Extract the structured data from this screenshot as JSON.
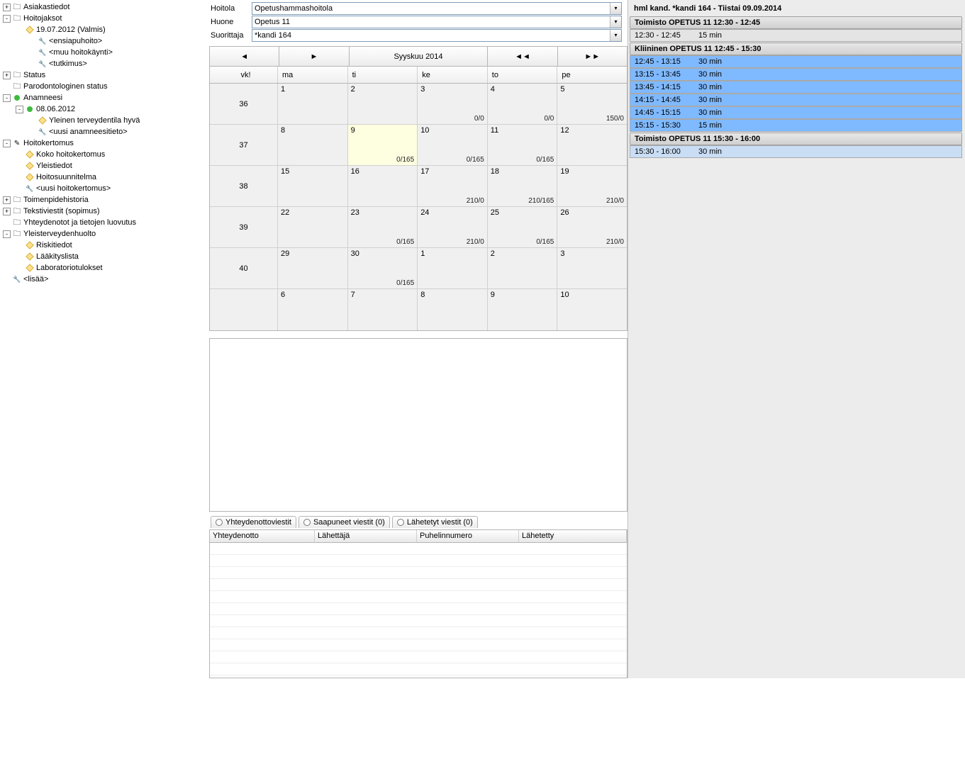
{
  "tree": [
    {
      "level": 0,
      "exp": "+",
      "icon": "folder",
      "label": "Asiakastiedot"
    },
    {
      "level": 0,
      "exp": "-",
      "icon": "folder",
      "label": "Hoitojaksot"
    },
    {
      "level": 1,
      "exp": "",
      "icon": "doc",
      "label": "19.07.2012 (Valmis)"
    },
    {
      "level": 2,
      "exp": "",
      "icon": "wrench",
      "label": "<ensiapuhoito>"
    },
    {
      "level": 2,
      "exp": "",
      "icon": "wrench",
      "label": "<muu hoitokäynti>"
    },
    {
      "level": 2,
      "exp": "",
      "icon": "wrench",
      "label": "<tutkimus>"
    },
    {
      "level": 0,
      "exp": "+",
      "icon": "folder",
      "label": "Status"
    },
    {
      "level": 0,
      "exp": "",
      "icon": "folder",
      "label": "Parodontologinen status"
    },
    {
      "level": 0,
      "exp": "-",
      "icon": "bullet",
      "label": "Anamneesi"
    },
    {
      "level": 1,
      "exp": "-",
      "icon": "bullet",
      "label": "08.06.2012"
    },
    {
      "level": 2,
      "exp": "",
      "icon": "doc",
      "label": "Yleinen terveydentila hyvä"
    },
    {
      "level": 2,
      "exp": "",
      "icon": "wrench",
      "label": "<uusi anamneesitieto>"
    },
    {
      "level": 0,
      "exp": "-",
      "icon": "pencil",
      "label": "Hoitokertomus"
    },
    {
      "level": 1,
      "exp": "",
      "icon": "doc",
      "label": "Koko hoitokertomus"
    },
    {
      "level": 1,
      "exp": "",
      "icon": "doc",
      "label": "Yleistiedot"
    },
    {
      "level": 1,
      "exp": "",
      "icon": "doc",
      "label": "Hoitosuunnitelma"
    },
    {
      "level": 1,
      "exp": "",
      "icon": "wrench",
      "label": "<uusi hoitokertomus>"
    },
    {
      "level": 0,
      "exp": "+",
      "icon": "folder",
      "label": "Toimenpidehistoria"
    },
    {
      "level": 0,
      "exp": "+",
      "icon": "folder",
      "label": "Tekstiviestit (sopimus)"
    },
    {
      "level": 0,
      "exp": "",
      "icon": "folder",
      "label": "Yhteydenotot ja tietojen luovutus"
    },
    {
      "level": 0,
      "exp": "-",
      "icon": "folder",
      "label": "Yleisterveydenhuolto"
    },
    {
      "level": 1,
      "exp": "",
      "icon": "doc",
      "label": "Riskitiedot"
    },
    {
      "level": 1,
      "exp": "",
      "icon": "doc",
      "label": "Lääkityslista"
    },
    {
      "level": 1,
      "exp": "",
      "icon": "doc",
      "label": "Laboratoriotulokset"
    },
    {
      "level": 0,
      "exp": "",
      "icon": "wrench",
      "label": "<lisää>"
    }
  ],
  "form": {
    "hoitola_label": "Hoitola",
    "hoitola_value": "Opetushammashoitola",
    "huone_label": "Huone",
    "huone_value": "Opetus 11",
    "suorittaja_label": "Suorittaja",
    "suorittaja_value": "*kandi 164"
  },
  "calendar": {
    "title": "Syyskuu 2014",
    "wk_label": "vk!",
    "days": [
      "ma",
      "ti",
      "ke",
      "to",
      "pe"
    ],
    "weeks": [
      {
        "wk": "36",
        "cells": [
          {
            "d": "1"
          },
          {
            "d": "2"
          },
          {
            "d": "3",
            "r": "0/0"
          },
          {
            "d": "4",
            "r": "0/0"
          },
          {
            "d": "5",
            "r": "150/0"
          }
        ]
      },
      {
        "wk": "37",
        "cells": [
          {
            "d": "8"
          },
          {
            "d": "9",
            "sel": true,
            "r": "0/165"
          },
          {
            "d": "10",
            "r": "0/165"
          },
          {
            "d": "11",
            "r": "0/165"
          },
          {
            "d": "12"
          }
        ]
      },
      {
        "wk": "38",
        "cells": [
          {
            "d": "15"
          },
          {
            "d": "16"
          },
          {
            "d": "17",
            "r": "210/0"
          },
          {
            "d": "18",
            "r": "210/165"
          },
          {
            "d": "19",
            "r": "210/0"
          }
        ]
      },
      {
        "wk": "39",
        "cells": [
          {
            "d": "22"
          },
          {
            "d": "23",
            "r": "0/165"
          },
          {
            "d": "24",
            "r": "210/0"
          },
          {
            "d": "25",
            "r": "0/165"
          },
          {
            "d": "26",
            "r": "210/0"
          }
        ]
      },
      {
        "wk": "40",
        "cells": [
          {
            "d": "29"
          },
          {
            "d": "30",
            "r": "0/165"
          },
          {
            "d": "1"
          },
          {
            "d": "2"
          },
          {
            "d": "3"
          }
        ]
      },
      {
        "wk": "",
        "cells": [
          {
            "d": "6"
          },
          {
            "d": "7"
          },
          {
            "d": "8"
          },
          {
            "d": "9"
          },
          {
            "d": "10"
          }
        ]
      }
    ],
    "nav": {
      "prev": "◄",
      "next": "►",
      "fast_prev": "◄◄",
      "fast_next": "►►"
    }
  },
  "tabs": {
    "t1": "Yhteydenottoviestit",
    "t2": "Saapuneet viestit (0)",
    "t3": "Lähetetyt viestit (0)"
  },
  "msg_header": [
    "Yhteydenotto",
    "Lähettäjä",
    "Puhelinnumero",
    "Lähetetty"
  ],
  "right": {
    "title": "hml kand. *kandi 164 - Tiistai 09.09.2014",
    "blocks": [
      {
        "type": "header",
        "cls": "",
        "text": "Toimisto OPETUS 11 12:30 - 12:45"
      },
      {
        "type": "slot",
        "cls": "gray",
        "time": "12:30 - 12:45",
        "dur": "15 min"
      },
      {
        "type": "header",
        "cls": "",
        "text": "Kliininen OPETUS 11 12:45 - 15:30"
      },
      {
        "type": "slot",
        "cls": "blue",
        "time": "12:45 - 13:15",
        "dur": "30 min"
      },
      {
        "type": "slot",
        "cls": "blue",
        "time": "13:15 - 13:45",
        "dur": "30 min"
      },
      {
        "type": "slot",
        "cls": "blue",
        "time": "13:45 - 14:15",
        "dur": "30 min"
      },
      {
        "type": "slot",
        "cls": "blue",
        "time": "14:15 - 14:45",
        "dur": "30 min"
      },
      {
        "type": "slot",
        "cls": "blue",
        "time": "14:45 - 15:15",
        "dur": "30 min"
      },
      {
        "type": "slot",
        "cls": "blue",
        "time": "15:15 - 15:30",
        "dur": "15 min"
      },
      {
        "type": "header",
        "cls": "",
        "text": "Toimisto OPETUS 11 15:30 - 16:00"
      },
      {
        "type": "slot",
        "cls": "lightblue",
        "time": "15:30 - 16:00",
        "dur": "30 min"
      }
    ]
  }
}
